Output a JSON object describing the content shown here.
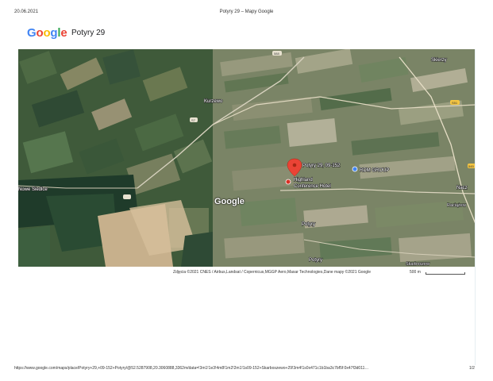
{
  "header": {
    "date": "20.06.2021",
    "title": "Potyry 29 – Mapy Google"
  },
  "logo": [
    "G",
    "o",
    "o",
    "g",
    "l",
    "e"
  ],
  "place_name": "Potyry 29",
  "map": {
    "labels": {
      "skierzy": "Skierzy",
      "kurzewo": "Kurzewo",
      "road_sign_1": "588",
      "road_sign_2": "S7",
      "road_sign_3": "S51",
      "road_sign_4": "545",
      "siedlc": "Nowe Siedlce",
      "pin_label": "Potyry 29, 09-152",
      "rdm": "RDM GROUP",
      "hotel_1": "Highland",
      "hotel_2": "Conference Hotel",
      "nacz_1": "Nacz",
      "nacz_2": "Raciążew",
      "potyry_1": "Potyry",
      "potyry_2": "Potyry",
      "sk": "Skarboszew"
    },
    "map_logo": "Google",
    "pin_color": "#EA4335",
    "hotel_color": "#D93025",
    "rdm_icon_color": "#4285F4"
  },
  "attribution": "Zdjęcia ©2021 CNES / Airbus,Landsat / Copernicus,MGGP Aero,Maxar Technologies,Dane mapy ©2021 Google",
  "scale": "500 m",
  "footer": {
    "url": "https://www.google.com/maps/place/Potyry+29,+09-152+Potyry/@52.5287908,20.3060888,3362m/data=!3m1!1e3!4m8!1m2!2m1!1s09-152+Skarboszewo+29!3m4!1s0x471c1b1ba3c7bf5f:0x47f3d011…",
    "page": "1/2"
  }
}
